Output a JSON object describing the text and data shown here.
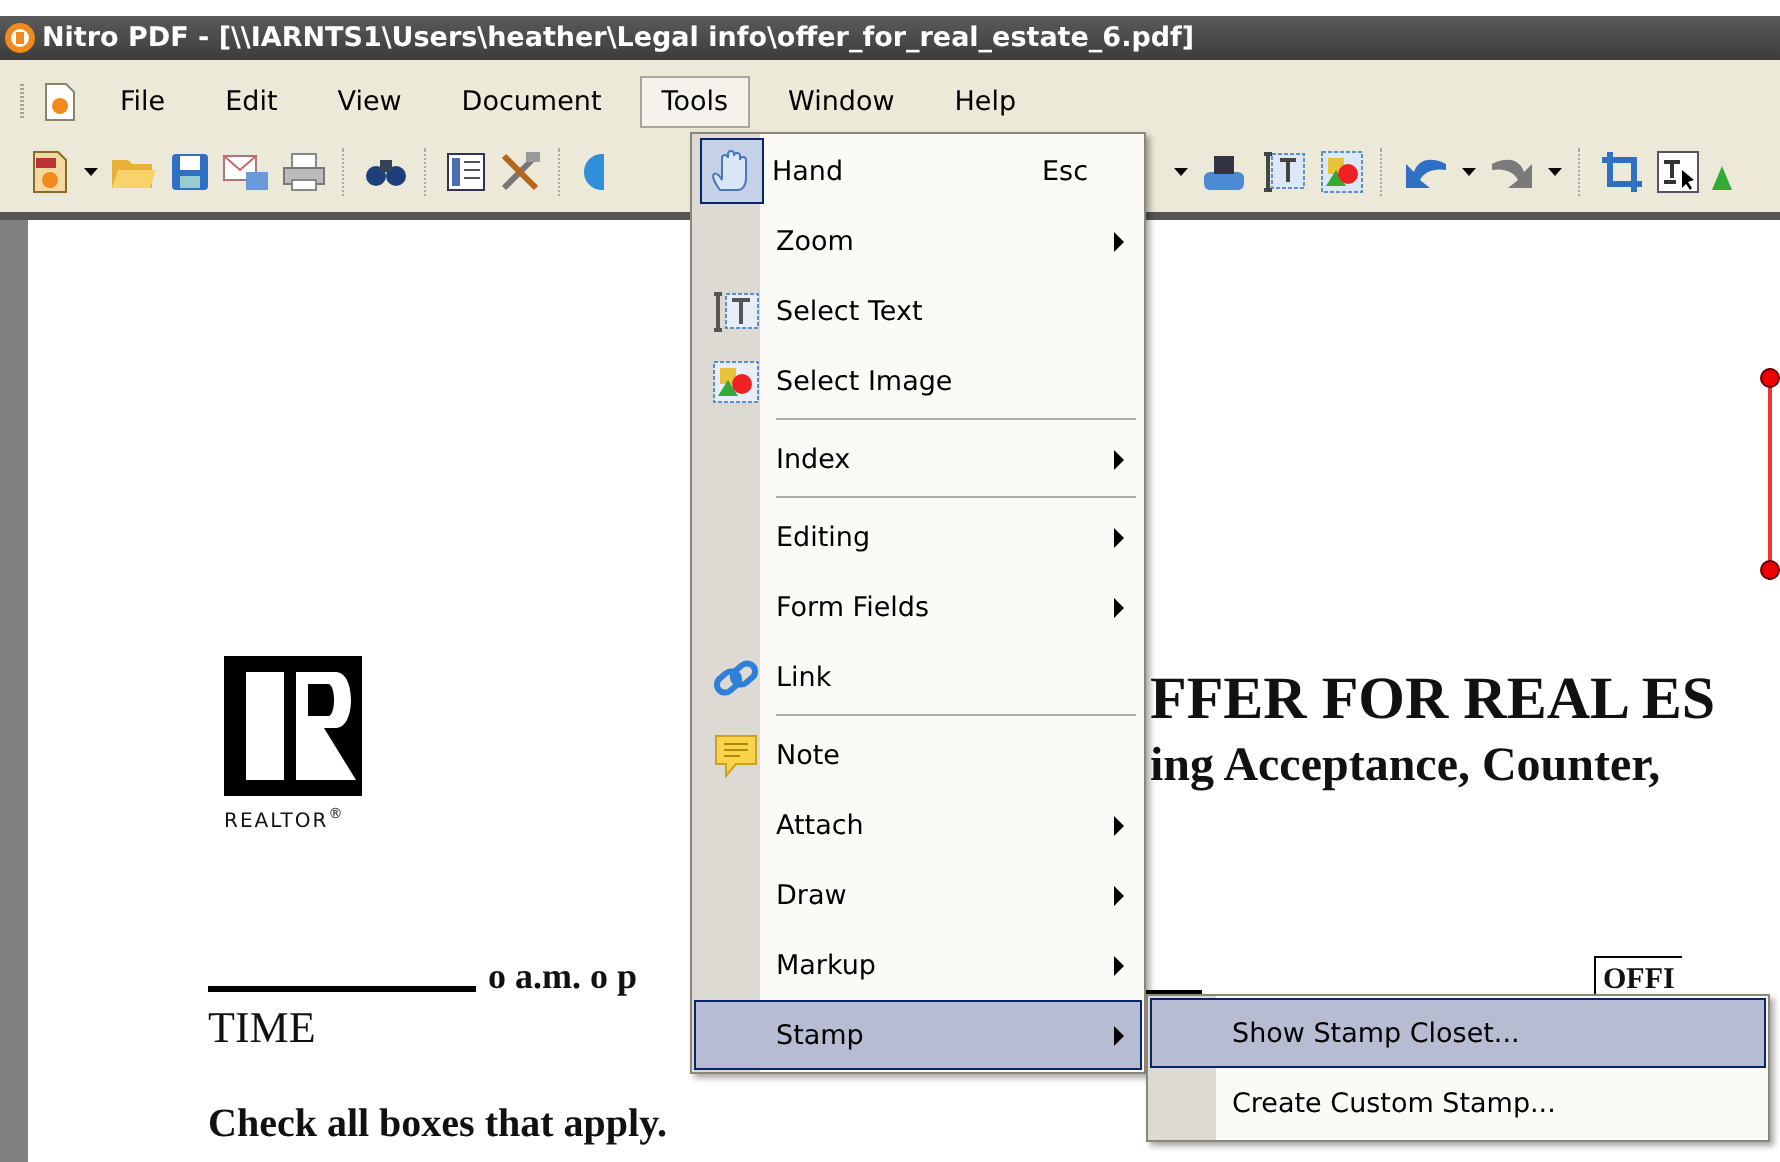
{
  "window": {
    "title": "Nitro PDF - [\\\\IARNTS1\\Users\\heather\\Legal info\\offer_for_real_estate_6.pdf]"
  },
  "menubar": [
    {
      "label": "File",
      "selected": false
    },
    {
      "label": "Edit",
      "selected": false
    },
    {
      "label": "View",
      "selected": false
    },
    {
      "label": "Document",
      "selected": false
    },
    {
      "label": "Tools",
      "selected": true
    },
    {
      "label": "Window",
      "selected": false
    },
    {
      "label": "Help",
      "selected": false
    }
  ],
  "tools_menu": [
    {
      "label": "Hand",
      "shortcut": "Esc",
      "submenu": false,
      "checked": true,
      "selected": false,
      "separator_after": false
    },
    {
      "label": "Zoom",
      "submenu": true,
      "checked": false,
      "selected": false,
      "separator_after": false
    },
    {
      "label": "Select Text",
      "submenu": false,
      "checked": false,
      "selected": false,
      "separator_after": false
    },
    {
      "label": "Select Image",
      "submenu": false,
      "checked": false,
      "selected": false,
      "separator_after": true
    },
    {
      "label": "Index",
      "submenu": true,
      "checked": false,
      "selected": false,
      "separator_after": true
    },
    {
      "label": "Editing",
      "submenu": true,
      "checked": false,
      "selected": false,
      "separator_after": false
    },
    {
      "label": "Form Fields",
      "submenu": true,
      "checked": false,
      "selected": false,
      "separator_after": false
    },
    {
      "label": "Link",
      "submenu": false,
      "checked": false,
      "selected": false,
      "separator_after": true
    },
    {
      "label": "Note",
      "submenu": false,
      "checked": false,
      "selected": false,
      "separator_after": false
    },
    {
      "label": "Attach",
      "submenu": true,
      "checked": false,
      "selected": false,
      "separator_after": false
    },
    {
      "label": "Draw",
      "submenu": true,
      "checked": false,
      "selected": false,
      "separator_after": false
    },
    {
      "label": "Markup",
      "submenu": true,
      "checked": false,
      "selected": false,
      "separator_after": false
    },
    {
      "label": "Stamp",
      "submenu": true,
      "checked": false,
      "selected": true,
      "separator_after": false
    }
  ],
  "stamp_submenu": [
    {
      "label": "Show Stamp Closet...",
      "selected": true
    },
    {
      "label": "Create Custom Stamp...",
      "selected": false
    }
  ],
  "document": {
    "logo_text": "REALTOR",
    "logo_mark": "®",
    "heading": "FFER FOR REAL ES",
    "subheading": "ing Acceptance, Counter,",
    "time_options": "o a.m. o p",
    "time_label": "TIME",
    "instruction": "Check all boxes that apply.",
    "office_box": "OFFI"
  }
}
